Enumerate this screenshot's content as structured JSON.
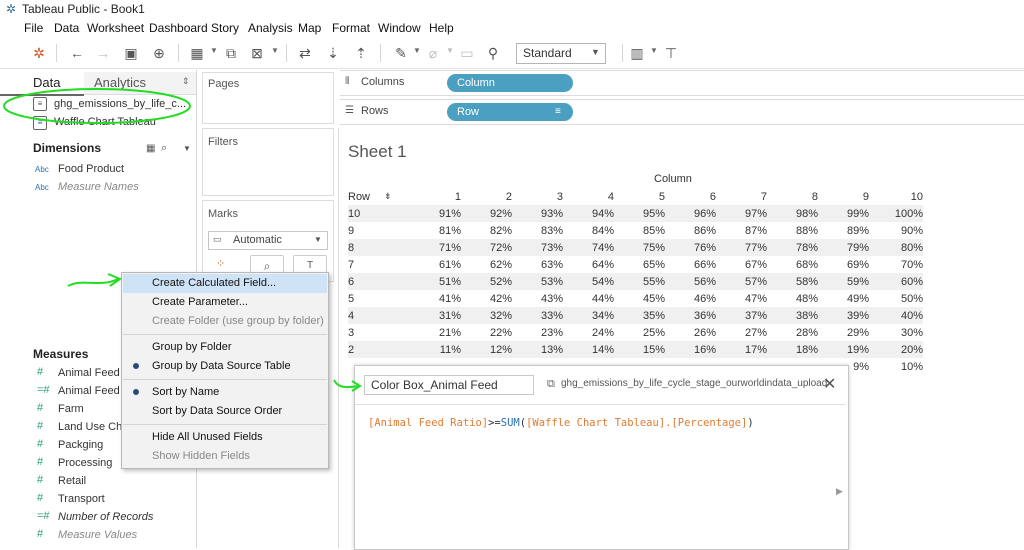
{
  "app": {
    "title": "Tableau Public - Book1"
  },
  "menu": [
    "File",
    "Data",
    "Worksheet",
    "Dashboard",
    "Story",
    "Analysis",
    "Map",
    "Format",
    "Window",
    "Help"
  ],
  "toolbar": {
    "fit_value": "Standard"
  },
  "data_pane": {
    "tabs": {
      "data": "Data",
      "analytics": "Analytics"
    },
    "sources": [
      "ghg_emissions_by_life_c...",
      "Waffle Chart Tableau"
    ],
    "dimensions_label": "Dimensions",
    "dimensions": [
      "Food Product",
      "Measure Names"
    ],
    "measures_label": "Measures",
    "measures": [
      "Animal Feed",
      "Animal Feed R",
      "Farm",
      "Land Use Cha",
      "Packging",
      "Processing",
      "Retail",
      "Transport",
      "Number of Records",
      "Measure Values"
    ]
  },
  "cards": {
    "pages": "Pages",
    "filters": "Filters",
    "marks": "Marks",
    "mark_type": "Automatic"
  },
  "shelves": {
    "columns_label": "Columns",
    "rows_label": "Rows",
    "column_pill": "Column",
    "row_pill": "Row"
  },
  "sheet": {
    "title": "Sheet 1",
    "column_header": "Column",
    "row_header": "Row",
    "columns": [
      "1",
      "2",
      "3",
      "4",
      "5",
      "6",
      "7",
      "8",
      "9",
      "10"
    ],
    "rows": [
      {
        "label": "10",
        "cells": [
          "91%",
          "92%",
          "93%",
          "94%",
          "95%",
          "96%",
          "97%",
          "98%",
          "99%",
          "100%"
        ]
      },
      {
        "label": "9",
        "cells": [
          "81%",
          "82%",
          "83%",
          "84%",
          "85%",
          "86%",
          "87%",
          "88%",
          "89%",
          "90%"
        ]
      },
      {
        "label": "8",
        "cells": [
          "71%",
          "72%",
          "73%",
          "74%",
          "75%",
          "76%",
          "77%",
          "78%",
          "79%",
          "80%"
        ]
      },
      {
        "label": "7",
        "cells": [
          "61%",
          "62%",
          "63%",
          "64%",
          "65%",
          "66%",
          "67%",
          "68%",
          "69%",
          "70%"
        ]
      },
      {
        "label": "6",
        "cells": [
          "51%",
          "52%",
          "53%",
          "54%",
          "55%",
          "56%",
          "57%",
          "58%",
          "59%",
          "60%"
        ]
      },
      {
        "label": "5",
        "cells": [
          "41%",
          "42%",
          "43%",
          "44%",
          "45%",
          "46%",
          "47%",
          "48%",
          "49%",
          "50%"
        ]
      },
      {
        "label": "4",
        "cells": [
          "31%",
          "32%",
          "33%",
          "34%",
          "35%",
          "36%",
          "37%",
          "38%",
          "39%",
          "40%"
        ]
      },
      {
        "label": "3",
        "cells": [
          "21%",
          "22%",
          "23%",
          "24%",
          "25%",
          "26%",
          "27%",
          "28%",
          "29%",
          "30%"
        ]
      },
      {
        "label": "2",
        "cells": [
          "11%",
          "12%",
          "13%",
          "14%",
          "15%",
          "16%",
          "17%",
          "18%",
          "19%",
          "20%"
        ]
      },
      {
        "label": "",
        "cells": [
          "",
          "",
          "",
          "",
          "",
          "",
          "",
          "",
          "9%",
          "10%"
        ]
      }
    ]
  },
  "context_menu": {
    "items": [
      {
        "label": "Create Calculated Field...",
        "highlighted": true
      },
      {
        "label": "Create Parameter..."
      },
      {
        "label": "Create Folder (use group by folder)",
        "disabled": true
      },
      {
        "label": "Group by Folder"
      },
      {
        "label": "Group by Data Source Table",
        "checked": true
      },
      {
        "label": "Sort by Name",
        "checked": true
      },
      {
        "label": "Sort by Data Source Order"
      },
      {
        "label": "Hide All Unused Fields"
      },
      {
        "label": "Show Hidden Fields",
        "disabled": true
      }
    ]
  },
  "calc_dialog": {
    "name_value": "Color Box_Animal Feed",
    "source": "ghg_emissions_by_life_cycle_stage_ourworldindata_upload",
    "formula": {
      "field": "[Animal Feed Ratio]",
      "op": ">=",
      "func": "SUM",
      "arg": "[Waffle Chart Tableau].[Percentage]"
    }
  },
  "colors": {
    "pill": "#4b9fc1",
    "annotation": "#22dd22",
    "menu_highlight": "#cfe3f7",
    "field_orange": "#e07b32"
  }
}
